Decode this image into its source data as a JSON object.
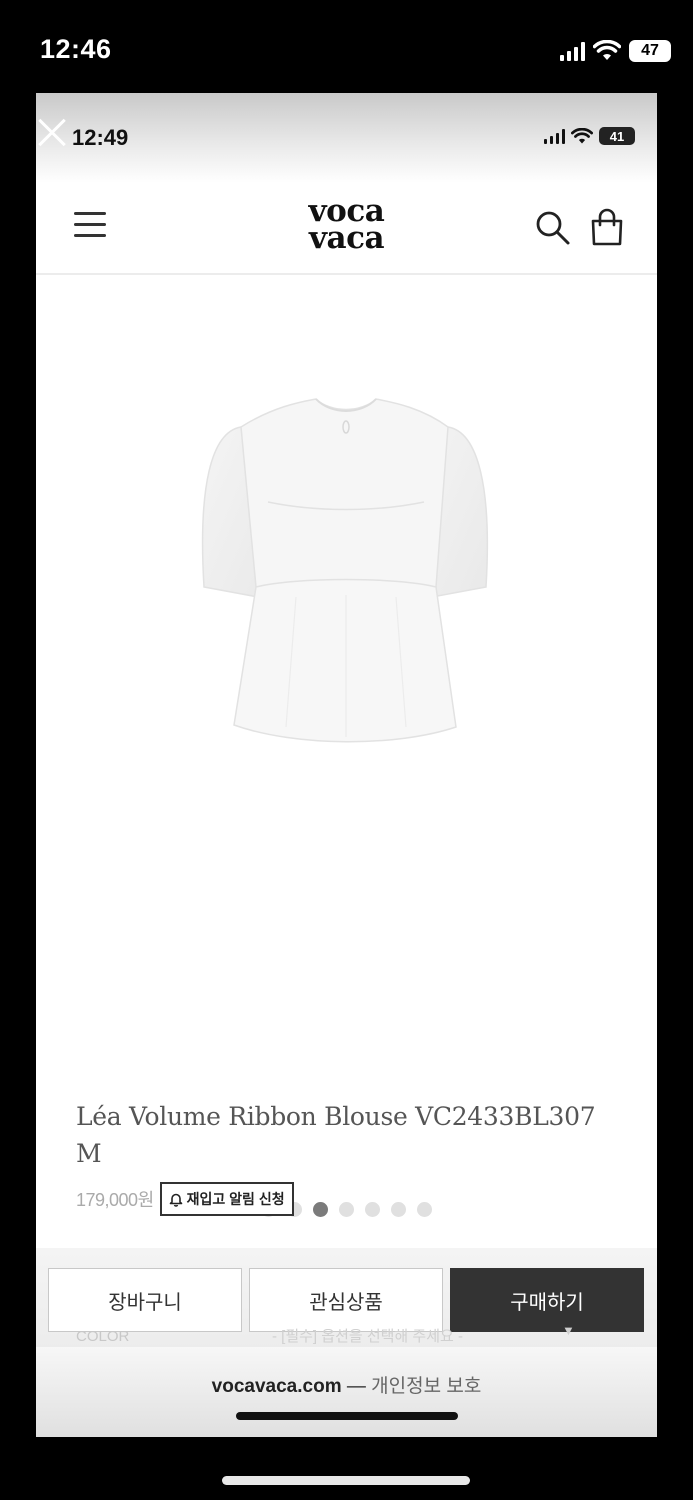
{
  "outer_status": {
    "time": "12:46",
    "battery": "47"
  },
  "inner_status": {
    "time": "12:49",
    "battery": "41"
  },
  "header": {
    "logo_line1": "voca",
    "logo_line2": "vaca",
    "icons": [
      "menu-icon",
      "search-icon",
      "shopping-bag-icon"
    ]
  },
  "gallery": {
    "total": 7,
    "active_index": 2
  },
  "product": {
    "name": "Léa Volume Ribbon Blouse VC2433BL307 M",
    "price": "179,000원",
    "restock_label": "재입고 알림 신청"
  },
  "actions": {
    "cart": "장바구니",
    "wishlist": "관심상품",
    "buy": "구매하기"
  },
  "options": {
    "color_label": "COLOR",
    "placeholder": "- [필수] 옵션을 선택해 주세요 -"
  },
  "browser": {
    "domain": "vocavaca.com",
    "separator": " — ",
    "privacy": "개인정보 보호"
  },
  "colors": {
    "buy_button": "#333333",
    "active_dot": "#7b7b7b"
  }
}
